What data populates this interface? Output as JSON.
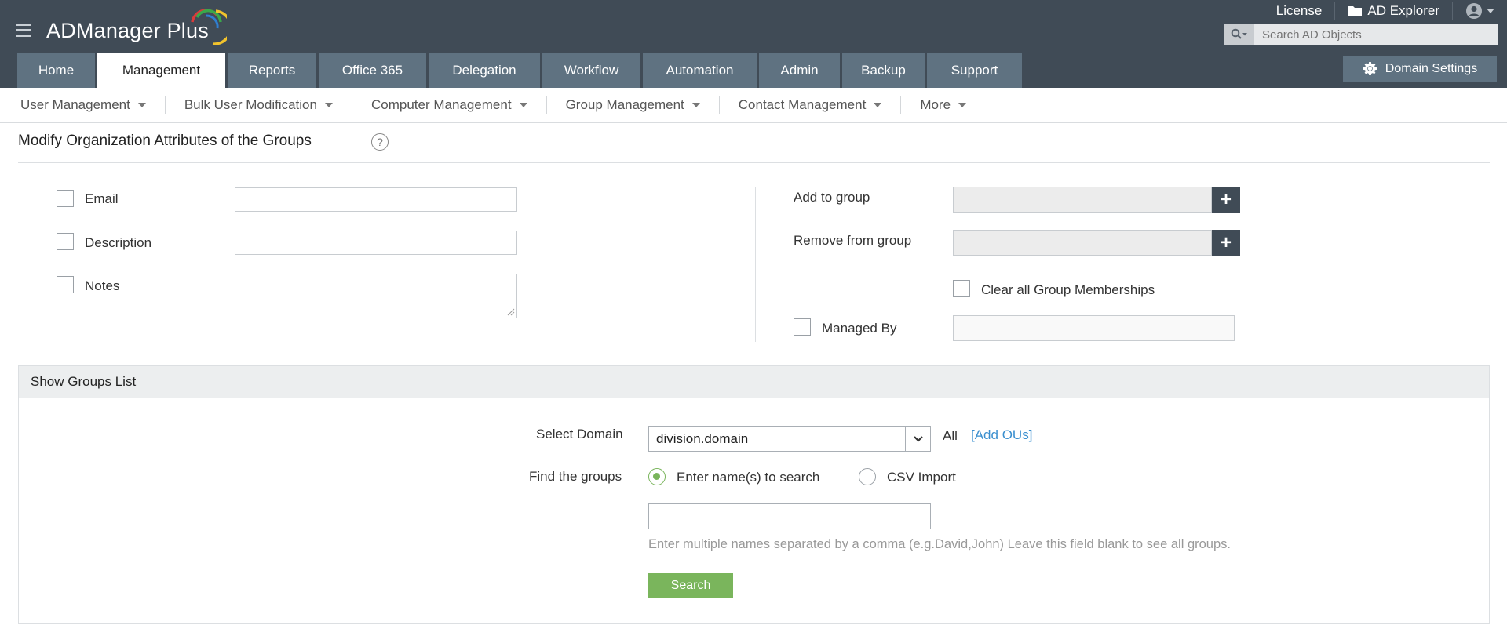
{
  "app": {
    "logo_main": "ADManager",
    "logo_plus": " Plus"
  },
  "top_links": {
    "license": "License",
    "ad_explorer": "AD Explorer"
  },
  "search": {
    "placeholder": "Search AD Objects"
  },
  "tabs": [
    {
      "label": "Home"
    },
    {
      "label": "Management"
    },
    {
      "label": "Reports"
    },
    {
      "label": "Office 365"
    },
    {
      "label": "Delegation"
    },
    {
      "label": "Workflow"
    },
    {
      "label": "Automation"
    },
    {
      "label": "Admin"
    },
    {
      "label": "Backup"
    },
    {
      "label": "Support"
    }
  ],
  "domain_settings": "Domain Settings",
  "subnav": [
    {
      "label": "User Management"
    },
    {
      "label": "Bulk User Modification"
    },
    {
      "label": "Computer Management"
    },
    {
      "label": "Group Management"
    },
    {
      "label": "Contact Management"
    },
    {
      "label": "More"
    }
  ],
  "page": {
    "title": "Modify Organization Attributes of the Groups",
    "help": "?"
  },
  "form": {
    "email_label": "Email",
    "description_label": "Description",
    "notes_label": "Notes",
    "add_to_group_label": "Add to group",
    "remove_from_group_label": "Remove from group",
    "plus": "+",
    "clear_memberships_label": "Clear all Group Memberships",
    "managed_by_label": "Managed By"
  },
  "groups_panel": {
    "title": "Show Groups List",
    "select_domain_label": "Select Domain",
    "domain_value": "division.domain",
    "all_label": "All",
    "add_ous": "[Add OUs]",
    "find_groups_label": "Find the groups",
    "radio_names": "Enter name(s) to search",
    "radio_csv": "CSV Import",
    "hint": "Enter multiple names separated by a comma (e.g.David,John) Leave this field blank to see all groups.",
    "search_button": "Search"
  },
  "colors": {
    "header_bg": "#404b56",
    "tab_bg": "#5f7281",
    "accent_green": "#7ab55c",
    "link_blue": "#3a8fcf"
  }
}
